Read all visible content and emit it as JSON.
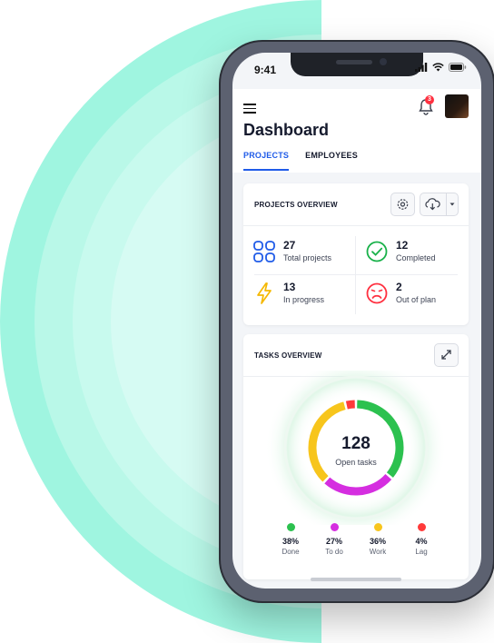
{
  "status": {
    "time": "9:41"
  },
  "header": {
    "title": "Dashboard",
    "notifications_count": "3",
    "tabs": [
      {
        "label": "PROJECTS",
        "active": true
      },
      {
        "label": "EMPLOYEES",
        "active": false
      }
    ]
  },
  "projects_overview": {
    "title": "PROJECTS OVERVIEW",
    "stats": [
      {
        "value": "27",
        "label": "Total projects",
        "icon": "grid-icon",
        "color": "#1f5be8"
      },
      {
        "value": "12",
        "label": "Completed",
        "icon": "check-circle-icon",
        "color": "#19b14a"
      },
      {
        "value": "13",
        "label": "In progress",
        "icon": "lightning-icon",
        "color": "#f5b800"
      },
      {
        "value": "2",
        "label": "Out of plan",
        "icon": "sad-face-icon",
        "color": "#ff3040"
      }
    ]
  },
  "tasks_overview": {
    "title": "TASKS OVERVIEW",
    "total": "128",
    "total_label": "Open tasks",
    "legend": [
      {
        "pct": "38%",
        "name": "Done",
        "color": "#2cc14f"
      },
      {
        "pct": "27%",
        "name": "To do",
        "color": "#d52ee0"
      },
      {
        "pct": "36%",
        "name": "Work",
        "color": "#f7c51c"
      },
      {
        "pct": "4%",
        "name": "Lag",
        "color": "#ff3a3a"
      }
    ]
  },
  "colors": {
    "accent": "#1f5be8",
    "background_arc": "#a6f5e2"
  }
}
